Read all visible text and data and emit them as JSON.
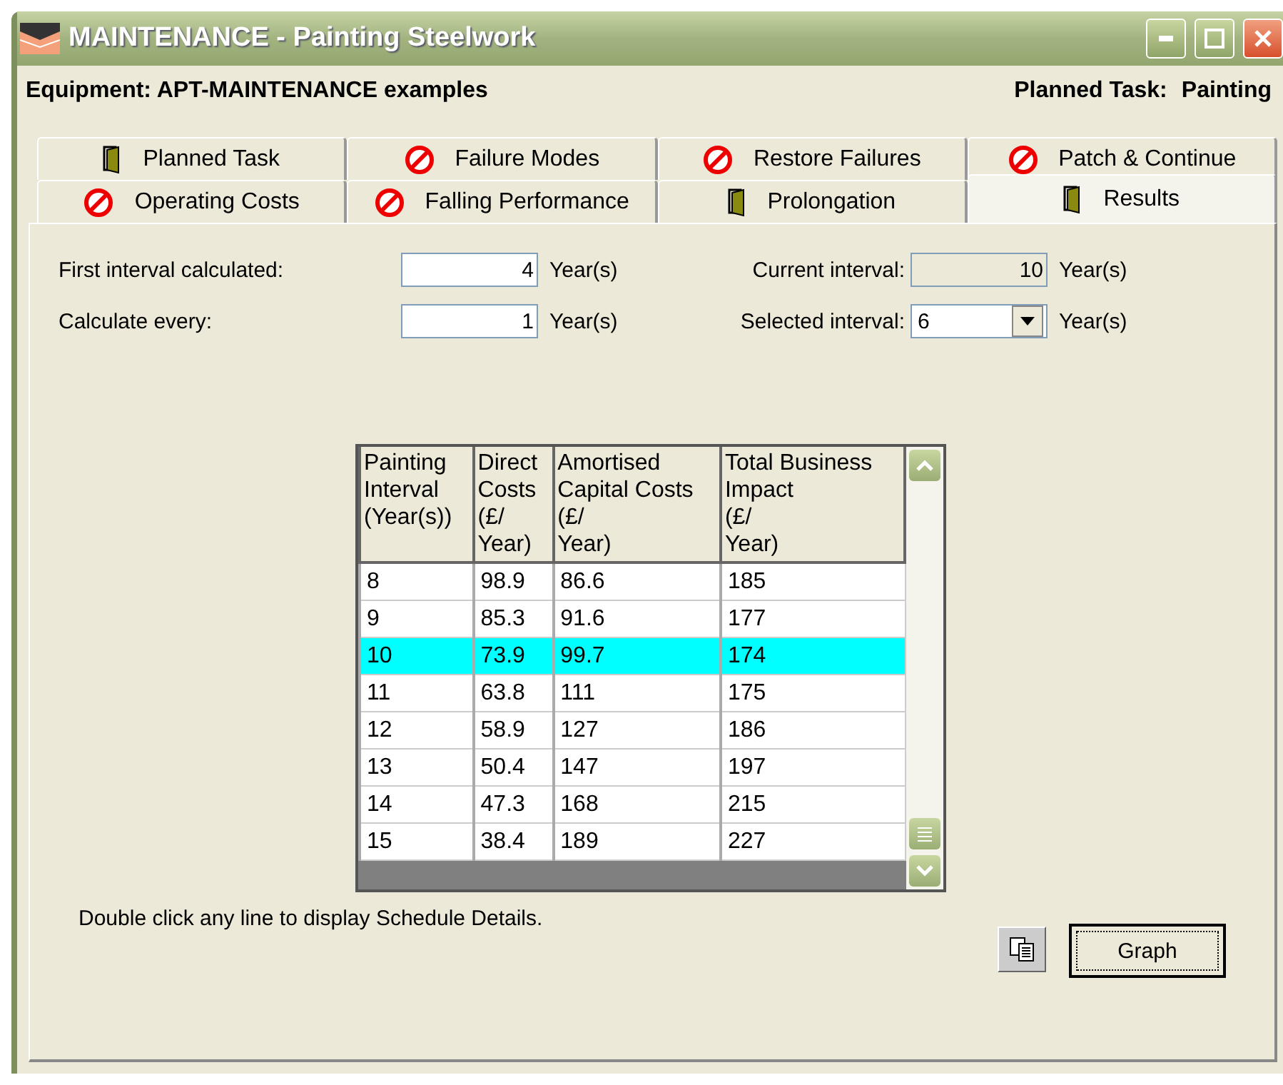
{
  "window": {
    "title": "MAINTENANCE - Painting Steelwork"
  },
  "header": {
    "equipment": "Equipment: APT-MAINTENANCE examples",
    "planned_task_label": "Planned Task:",
    "planned_task": "Painting"
  },
  "tab_rows": [
    [
      {
        "label": "Planned Task",
        "kind": "door",
        "selected": false
      },
      {
        "label": "Failure Modes",
        "kind": "stop",
        "selected": false
      },
      {
        "label": "Restore Failures",
        "kind": "stop",
        "selected": false
      },
      {
        "label": "Patch & Continue",
        "kind": "stop",
        "selected": false
      }
    ],
    [
      {
        "label": "Operating Costs",
        "kind": "stop",
        "selected": false
      },
      {
        "label": "Falling Performance",
        "kind": "stop",
        "selected": false
      },
      {
        "label": "Prolongation",
        "kind": "door",
        "selected": false
      },
      {
        "label": "Results",
        "kind": "door",
        "selected": true
      }
    ]
  ],
  "fields": {
    "first_interval": {
      "label": "First interval calculated:",
      "value": "4",
      "unit": "Year(s)"
    },
    "calculate_every": {
      "label": "Calculate every:",
      "value": "1",
      "unit": "Year(s)"
    },
    "current_interval": {
      "label": "Current interval:",
      "value": "10",
      "unit": "Year(s)",
      "disabled": true
    },
    "selected_interval": {
      "label": "Selected interval:",
      "value": "6",
      "unit": "Year(s)"
    }
  },
  "table": {
    "columns": [
      {
        "lines": [
          "Painting",
          "Interval",
          "(Year(s))"
        ]
      },
      {
        "lines": [
          "Direct",
          "Costs",
          "(£/",
          "Year)"
        ]
      },
      {
        "lines": [
          "Amortised",
          "Capital Costs",
          "(£/",
          "Year)"
        ]
      },
      {
        "lines": [
          "Total Business",
          "Impact",
          "(£/",
          "Year)"
        ]
      }
    ],
    "rows": [
      {
        "cells": [
          "8",
          "98.9",
          "86.6",
          "185"
        ],
        "selected": false
      },
      {
        "cells": [
          "9",
          "85.3",
          "91.6",
          "177"
        ],
        "selected": false
      },
      {
        "cells": [
          "10",
          "73.9",
          "99.7",
          "174"
        ],
        "selected": true
      },
      {
        "cells": [
          "11",
          "63.8",
          "111",
          "175"
        ],
        "selected": false
      },
      {
        "cells": [
          "12",
          "58.9",
          "127",
          "186"
        ],
        "selected": false
      },
      {
        "cells": [
          "13",
          "50.4",
          "147",
          "197"
        ],
        "selected": false
      },
      {
        "cells": [
          "14",
          "47.3",
          "168",
          "215"
        ],
        "selected": false
      },
      {
        "cells": [
          "15",
          "38.4",
          "189",
          "227"
        ],
        "selected": false
      }
    ]
  },
  "hint": "Double click any line to display Schedule Details.",
  "buttons": {
    "graph": "Graph"
  }
}
